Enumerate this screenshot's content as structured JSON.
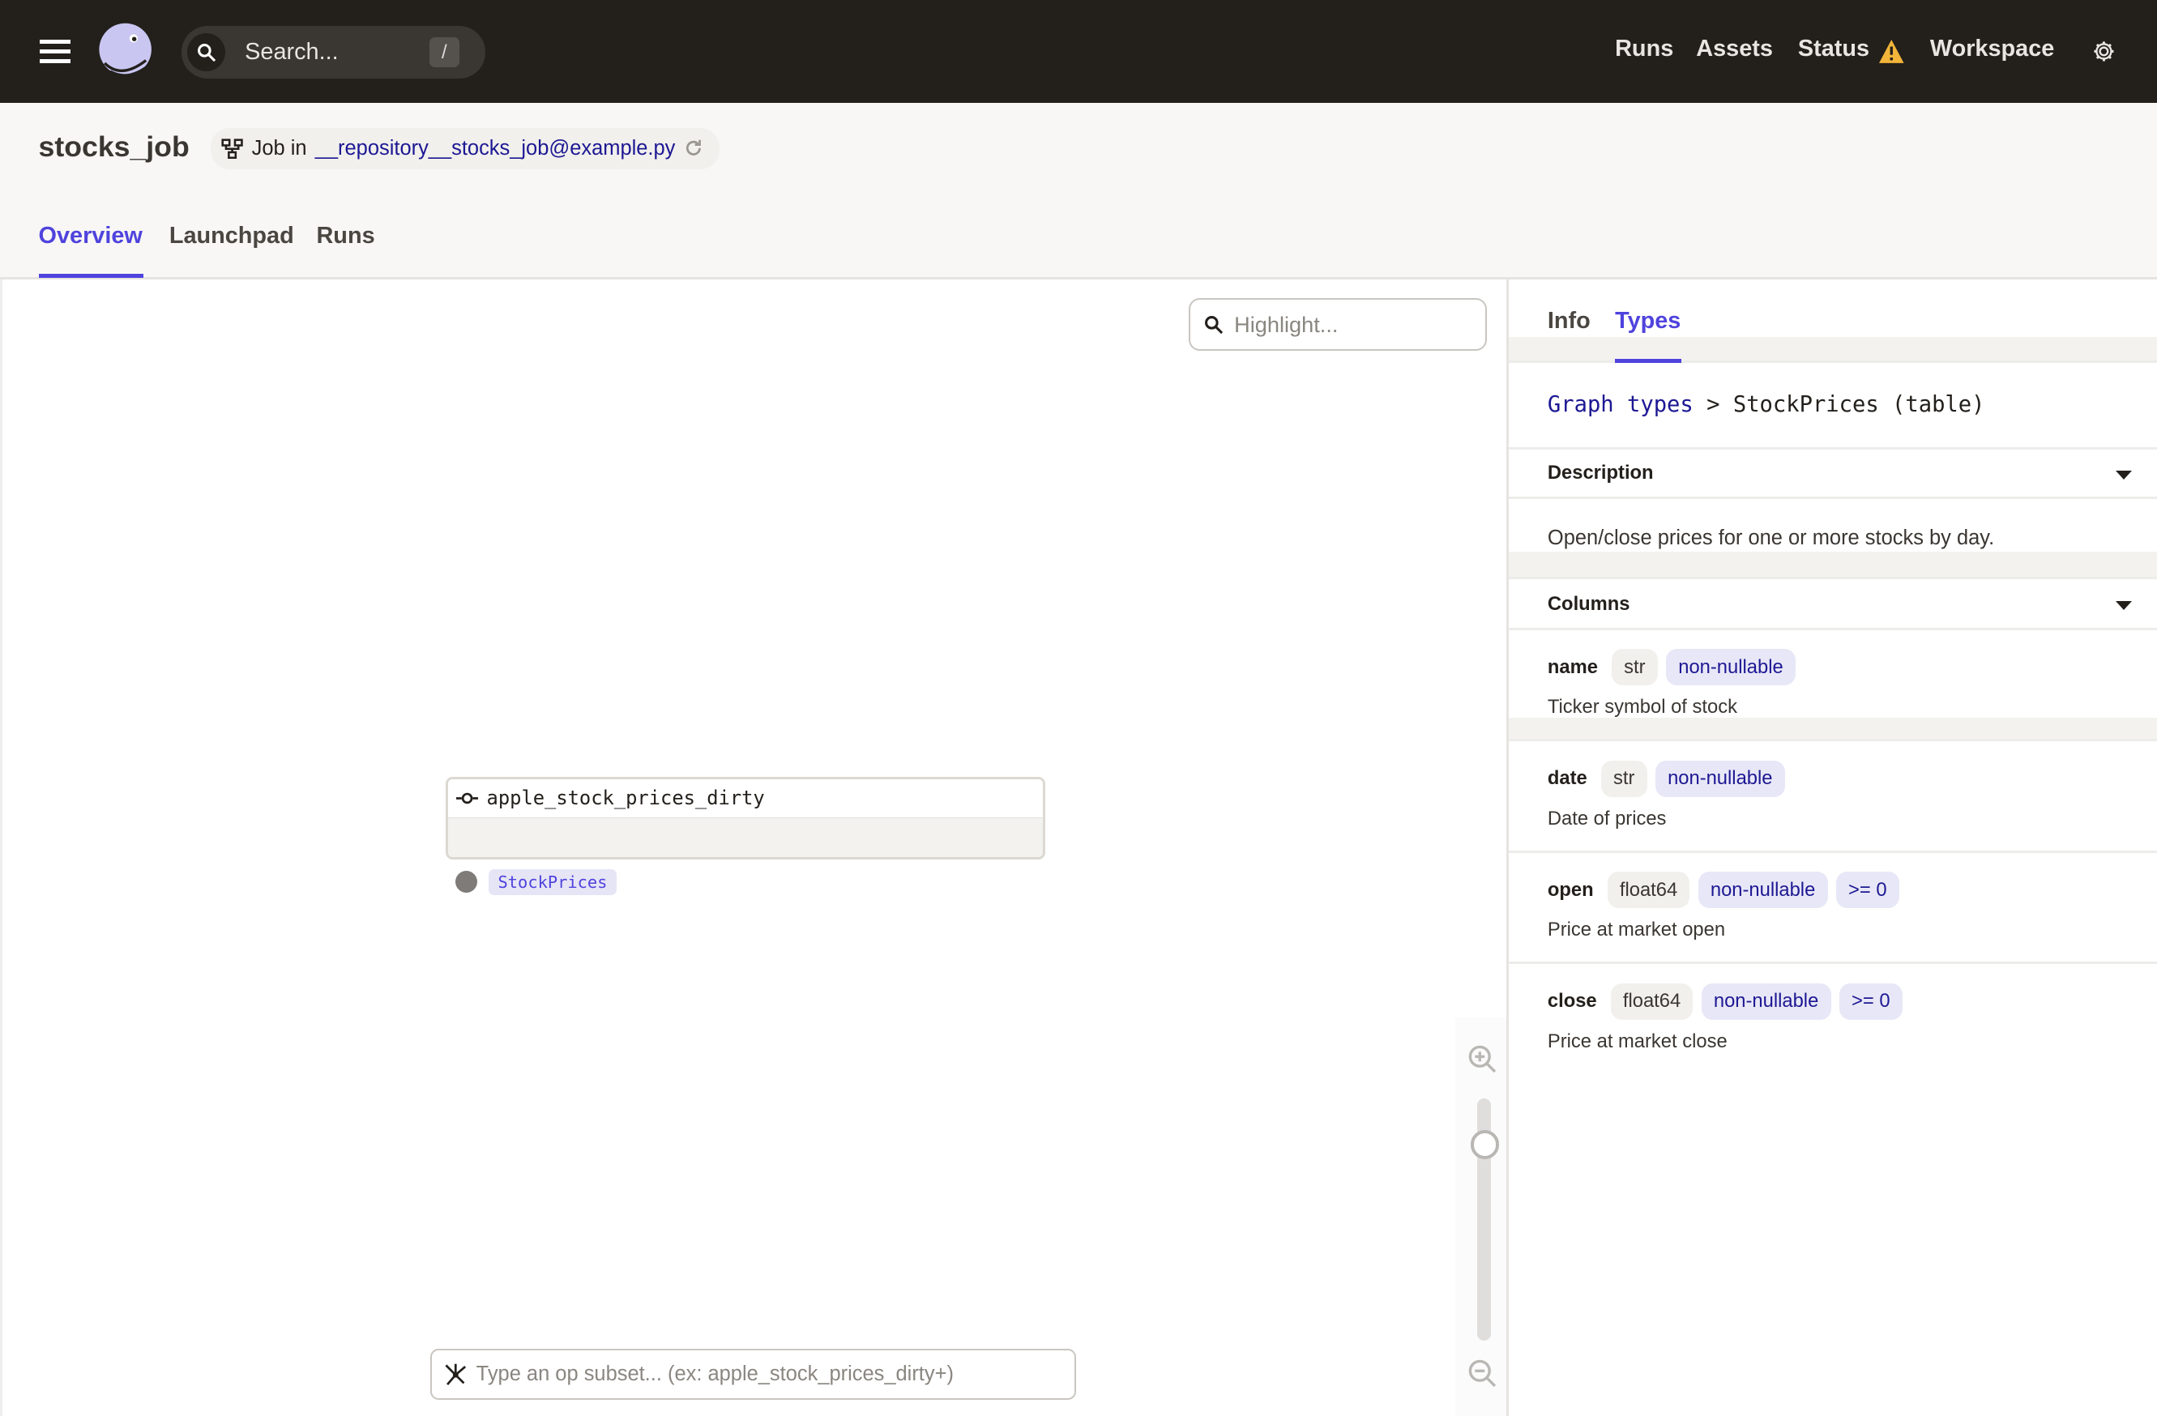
{
  "topbar": {
    "search_placeholder": "Search...",
    "search_shortcut": "/",
    "nav": [
      "Runs",
      "Assets",
      "Status",
      "Workspace"
    ],
    "status_warning_color": "#f2b53a"
  },
  "header": {
    "title": "stocks_job",
    "job_prefix": "Job in",
    "repository_link": "__repository__stocks_job@example.py",
    "tabs": [
      "Overview",
      "Launchpad",
      "Runs"
    ],
    "active_tab": "Overview"
  },
  "canvas": {
    "highlight_placeholder": "Highlight...",
    "node": {
      "name": "apple_stock_prices_dirty",
      "output_type": "StockPrices"
    },
    "subset_placeholder": "Type an op subset... (ex: apple_stock_prices_dirty+)",
    "zoom_level": 0.81
  },
  "sidebar": {
    "tabs": [
      "Info",
      "Types"
    ],
    "active_tab": "Types",
    "breadcrumb": {
      "link": "Graph types",
      "separator": ">",
      "current": "StockPrices (table)"
    },
    "description_header": "Description",
    "description": "Open/close prices for one or more stocks by day.",
    "columns_header": "Columns",
    "columns": [
      {
        "name": "name",
        "type": "str",
        "constraints": [
          "non-nullable"
        ],
        "description": "Ticker symbol of stock"
      },
      {
        "name": "date",
        "type": "str",
        "constraints": [
          "non-nullable"
        ],
        "description": "Date of prices"
      },
      {
        "name": "open",
        "type": "float64",
        "constraints": [
          "non-nullable",
          ">= 0"
        ],
        "description": "Price at market open"
      },
      {
        "name": "close",
        "type": "float64",
        "constraints": [
          "non-nullable",
          ">= 0"
        ],
        "description": "Price at market close"
      }
    ]
  },
  "colors": {
    "accent": "#4f43dd",
    "topbar": "#231f1b",
    "link": "#1d1893"
  }
}
